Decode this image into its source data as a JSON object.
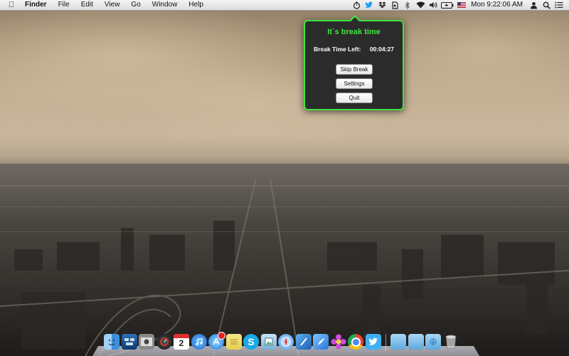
{
  "menubar": {
    "app_name": "Finder",
    "menus": [
      "File",
      "Edit",
      "View",
      "Go",
      "Window",
      "Help"
    ],
    "clock": "Mon 9:22:06 AM",
    "status_icons": [
      "timer-icon",
      "twitter-icon",
      "dropbox-icon",
      "evernote-icon",
      "bluetooth-icon",
      "wifi-icon",
      "volume-icon",
      "battery-icon",
      "flag-icon",
      "user-icon",
      "spotlight-icon",
      "notification-center-icon"
    ]
  },
  "popover": {
    "title": "It`s break time",
    "time_left_label": "Break Time Left:",
    "time_left_value": "00:04:27",
    "skip_label": "Skip Break",
    "settings_label": "Settings",
    "quit_label": "Quit"
  },
  "dock": {
    "calendar_day": "2",
    "apps": [
      "finder",
      "mission-control",
      "photo-booth",
      "launchpad-dashboard",
      "calendar",
      "itunes",
      "app-store",
      "notes",
      "skype",
      "preview",
      "safari",
      "xcode",
      "pages",
      "flower-app",
      "chrome",
      "twitter"
    ],
    "folders": [
      "applications-folder",
      "documents-folder",
      "downloads-folder",
      "trash"
    ]
  },
  "colors": {
    "accent_green": "#3ee63e",
    "popover_bg": "#2b2b2b"
  }
}
